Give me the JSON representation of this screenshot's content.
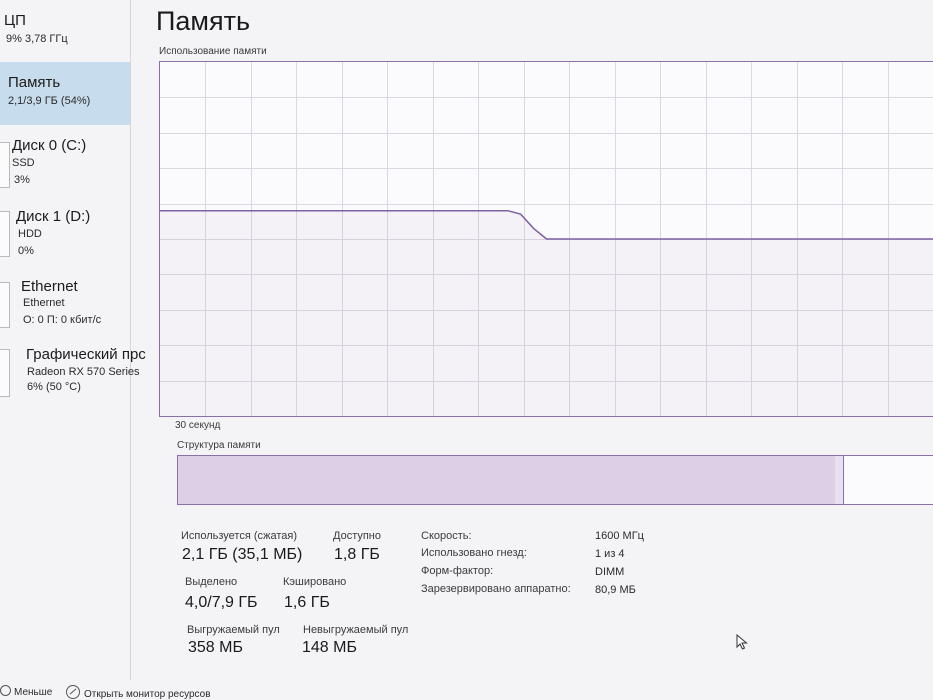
{
  "sidebar": {
    "items": [
      {
        "title": "ЦП",
        "line1": "9% 3,78 ГГц",
        "line2": ""
      },
      {
        "title": "Память",
        "line1": "2,1/3,9 ГБ (54%)",
        "line2": ""
      },
      {
        "title": "Диск 0 (C:)",
        "line1": "SSD",
        "line2": "3%"
      },
      {
        "title": "Диск 1 (D:)",
        "line1": "HDD",
        "line2": "0%"
      },
      {
        "title": "Ethernet",
        "line1": "Ethernet",
        "line2": "О: 0 П: 0 кбит/с"
      },
      {
        "title": "Графический прс",
        "line1": "Radeon RX 570 Series",
        "line2": "6% (50 °C)"
      }
    ],
    "selected_index": 1
  },
  "main": {
    "title": "Память",
    "graph_label": "Использование памяти",
    "time_label": "30 секунд",
    "structure_label": "Структура памяти"
  },
  "chart_data": {
    "type": "line",
    "x_range": [
      0,
      60
    ],
    "ylim": [
      0,
      100
    ],
    "grid": true,
    "series": [
      {
        "values": [
          58,
          58,
          58,
          58,
          58,
          58,
          58,
          58,
          58,
          58,
          58,
          58,
          58,
          58,
          58,
          58,
          58,
          58,
          58,
          58,
          58,
          58,
          58,
          58,
          58,
          58,
          58,
          58,
          57,
          53,
          50,
          50,
          50,
          50,
          50,
          50,
          50,
          50,
          50,
          50,
          50,
          50,
          50,
          50,
          50,
          50,
          50,
          50,
          50,
          50,
          50,
          50,
          50,
          50,
          50,
          50,
          50,
          50,
          50,
          50,
          50
        ]
      }
    ]
  },
  "structure": {
    "in_use_fraction": 0.869,
    "modified_fraction": 0.01,
    "colors": {
      "in_use": "#dccfe6",
      "modified": "#e9e0ef",
      "free": "#fbfafc"
    }
  },
  "stats": {
    "in_use_label": "Используется (сжатая)",
    "in_use_value": "2,1 ГБ (35,1 МБ)",
    "available_label": "Доступно",
    "available_value": "1,8 ГБ",
    "committed_label": "Выделено",
    "committed_value": "4,0/7,9 ГБ",
    "cached_label": "Кэшировано",
    "cached_value": "1,6 ГБ",
    "paged_label": "Выгружаемый пул",
    "paged_value": "358 МБ",
    "nonpaged_label": "Невыгружаемый пул",
    "nonpaged_value": "148 МБ"
  },
  "props": [
    {
      "label": "Скорость:",
      "value": "1600 МГц"
    },
    {
      "label": "Использовано гнезд:",
      "value": "1 из 4"
    },
    {
      "label": "Форм-фактор:",
      "value": "DIMM"
    },
    {
      "label": "Зарезервировано аппаратно:",
      "value": "80,9 МБ"
    }
  ],
  "footer": {
    "less_label": "Меньше",
    "monitor_label": "Открыть монитор ресурсов"
  },
  "colors": {
    "accent": "#8a6fa8",
    "line": "#7c61a0",
    "grid": "#dcd8e2",
    "selected": "#c7dcec"
  }
}
